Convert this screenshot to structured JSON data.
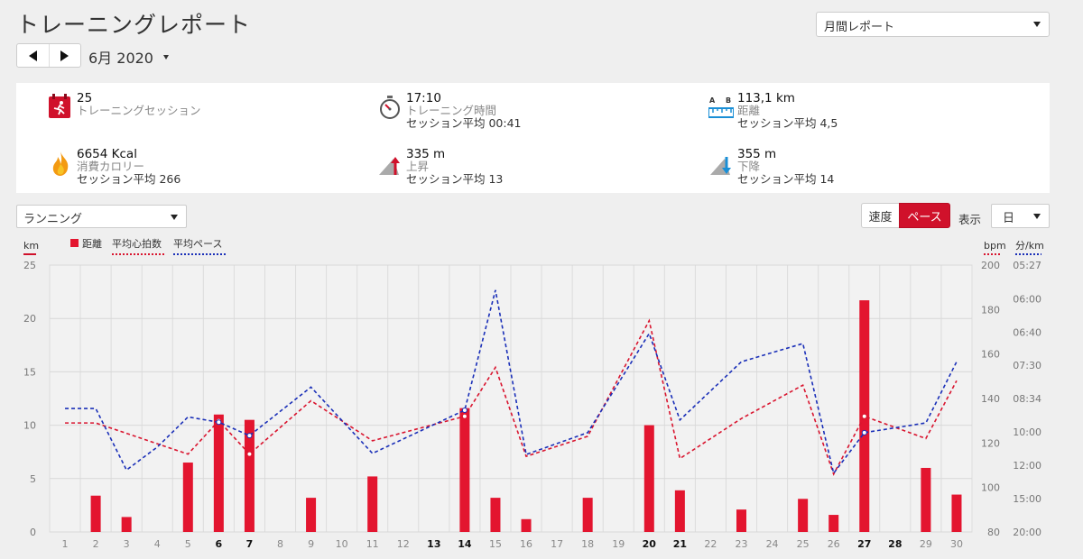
{
  "header": {
    "title": "トレーニングレポート",
    "report_type": "月間レポート",
    "period": "6月 2020"
  },
  "stats": [
    {
      "id": "sessions",
      "icon": "calendar-runner-icon",
      "value": "25",
      "label": "トレーニングセッション",
      "avg": ""
    },
    {
      "id": "time",
      "icon": "stopwatch-icon",
      "value": "17:10",
      "label": "トレーニング時間",
      "avg": "セッション平均 00:41"
    },
    {
      "id": "distance",
      "icon": "ruler-icon",
      "value": "113,1 km",
      "label": "距離",
      "avg": "セッション平均 4,5"
    },
    {
      "id": "calories",
      "icon": "flame-icon",
      "value": "6654 Kcal",
      "label": "消費カロリー",
      "avg": "セッション平均 266"
    },
    {
      "id": "ascent",
      "icon": "ascent-icon",
      "value": "335 m",
      "label": "上昇",
      "avg": "セッション平均 13"
    },
    {
      "id": "descent",
      "icon": "descent-icon",
      "value": "355 m",
      "label": "下降",
      "avg": "セッション平均 14"
    }
  ],
  "controls": {
    "sport": "ランニング",
    "speed_label": "速度",
    "pace_label": "ペース",
    "display_label": "表示",
    "view": "日"
  },
  "colors": {
    "accent": "#d0112b",
    "distance_bar": "#e3152f",
    "heart_rate": "#d9152f",
    "pace": "#1a2fb8"
  },
  "chart_data": {
    "type": "bar",
    "categories": [
      "1",
      "2",
      "3",
      "4",
      "5",
      "6",
      "7",
      "8",
      "9",
      "10",
      "11",
      "12",
      "13",
      "14",
      "15",
      "16",
      "17",
      "18",
      "19",
      "20",
      "21",
      "22",
      "23",
      "24",
      "25",
      "26",
      "27",
      "28",
      "29",
      "30"
    ],
    "bold_categories": [
      "6",
      "7",
      "13",
      "14",
      "20",
      "21",
      "27",
      "28"
    ],
    "legend": [
      "距離",
      "平均心拍数",
      "平均ペース"
    ],
    "left_axis": {
      "unit": "km",
      "ticks": [
        "0",
        "5",
        "10",
        "15",
        "20",
        "25"
      ],
      "range": [
        0,
        25
      ]
    },
    "hr_axis": {
      "unit": "bpm",
      "ticks": [
        "80",
        "100",
        "120",
        "140",
        "160",
        "180",
        "200"
      ],
      "range": [
        80,
        200
      ]
    },
    "pace_axis": {
      "unit": "分/km",
      "ticks": [
        "20:00",
        "15:00",
        "12:00",
        "10:00",
        "08:34",
        "07:30",
        "06:40",
        "06:00",
        "05:27"
      ]
    },
    "series": [
      {
        "name": "距離",
        "type": "bar",
        "values": [
          0,
          3.4,
          1.4,
          0,
          6.5,
          11,
          10.5,
          0,
          3.2,
          0,
          5.2,
          0,
          0,
          11.6,
          3.2,
          1.2,
          0,
          3.2,
          0,
          10,
          3.9,
          0,
          2.1,
          0,
          3.1,
          1.6,
          21.7,
          0,
          6,
          3.5
        ]
      },
      {
        "name": "平均心拍数",
        "type": "line",
        "points": [
          [
            1,
            129
          ],
          [
            2,
            129
          ],
          [
            5,
            115
          ],
          [
            6,
            130
          ],
          [
            7,
            115
          ],
          [
            9,
            139
          ],
          [
            11,
            121
          ],
          [
            14,
            132
          ],
          [
            15,
            154
          ],
          [
            16,
            114
          ],
          [
            18,
            123
          ],
          [
            20,
            175
          ],
          [
            21,
            113
          ],
          [
            23,
            131
          ],
          [
            25,
            146
          ],
          [
            26,
            106
          ],
          [
            27,
            132
          ],
          [
            29,
            122
          ],
          [
            30,
            148
          ]
        ]
      },
      {
        "name": "平均ペース",
        "type": "line",
        "points": [
          [
            1,
            "08:57"
          ],
          [
            2,
            "08:57"
          ],
          [
            3,
            "12:21"
          ],
          [
            4,
            "10:49"
          ],
          [
            5,
            "09:18"
          ],
          [
            6,
            "09:32"
          ],
          [
            7,
            "10:11"
          ],
          [
            9,
            "08:10"
          ],
          [
            11,
            "11:12"
          ],
          [
            14,
            "09:01"
          ],
          [
            15,
            "05:51"
          ],
          [
            16,
            "11:16"
          ],
          [
            18,
            "10:02"
          ],
          [
            20,
            "06:42"
          ],
          [
            21,
            "09:26"
          ],
          [
            23,
            "07:24"
          ],
          [
            25,
            "06:56"
          ],
          [
            26,
            "12:36"
          ],
          [
            27,
            "10:02"
          ],
          [
            29,
            "09:34"
          ],
          [
            30,
            "07:24"
          ]
        ]
      }
    ]
  }
}
